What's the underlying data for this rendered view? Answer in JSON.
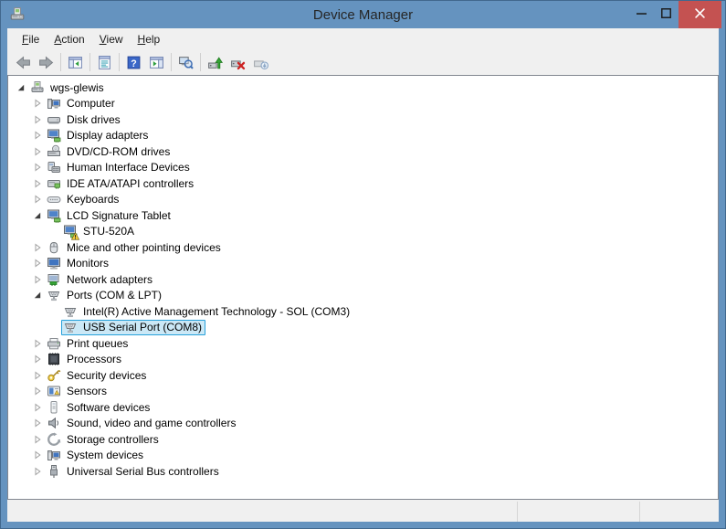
{
  "window": {
    "title": "Device Manager"
  },
  "menu": {
    "items": [
      {
        "label": "File"
      },
      {
        "label": "Action"
      },
      {
        "label": "View"
      },
      {
        "label": "Help"
      }
    ]
  },
  "toolbar": {
    "groups": [
      {
        "buttons": [
          {
            "name": "back",
            "enabled": false
          },
          {
            "name": "forward",
            "enabled": false
          }
        ]
      },
      {
        "buttons": [
          {
            "name": "show-hide-console-tree",
            "enabled": true
          }
        ]
      },
      {
        "buttons": [
          {
            "name": "properties",
            "enabled": true
          }
        ]
      },
      {
        "buttons": [
          {
            "name": "help",
            "enabled": true
          },
          {
            "name": "show-hide-action-pane",
            "enabled": true
          }
        ]
      },
      {
        "buttons": [
          {
            "name": "scan-for-hardware-changes",
            "enabled": true
          }
        ]
      },
      {
        "buttons": [
          {
            "name": "update-driver",
            "enabled": true
          },
          {
            "name": "uninstall",
            "enabled": true
          },
          {
            "name": "disable",
            "enabled": true
          }
        ]
      }
    ]
  },
  "tree": {
    "items": [
      {
        "label": "wgs-glewis",
        "depth": 0,
        "state": "expanded",
        "icon": "computer-station-icon"
      },
      {
        "label": "Computer",
        "depth": 1,
        "state": "collapsed",
        "icon": "computer-icon"
      },
      {
        "label": "Disk drives",
        "depth": 1,
        "state": "collapsed",
        "icon": "disk-drive-icon"
      },
      {
        "label": "Display adapters",
        "depth": 1,
        "state": "collapsed",
        "icon": "display-adapter-icon"
      },
      {
        "label": "DVD/CD-ROM drives",
        "depth": 1,
        "state": "collapsed",
        "icon": "dvd-drive-icon"
      },
      {
        "label": "Human Interface Devices",
        "depth": 1,
        "state": "collapsed",
        "icon": "hid-icon"
      },
      {
        "label": "IDE ATA/ATAPI controllers",
        "depth": 1,
        "state": "collapsed",
        "icon": "ide-controller-icon"
      },
      {
        "label": "Keyboards",
        "depth": 1,
        "state": "collapsed",
        "icon": "keyboard-icon"
      },
      {
        "label": "LCD Signature Tablet",
        "depth": 1,
        "state": "expanded",
        "icon": "display-adapter-icon"
      },
      {
        "label": "STU-520A",
        "depth": 2,
        "state": "none",
        "icon": "display-adapter-icon",
        "warning": true
      },
      {
        "label": "Mice and other pointing devices",
        "depth": 1,
        "state": "collapsed",
        "icon": "mouse-icon"
      },
      {
        "label": "Monitors",
        "depth": 1,
        "state": "collapsed",
        "icon": "monitor-icon"
      },
      {
        "label": "Network adapters",
        "depth": 1,
        "state": "collapsed",
        "icon": "network-adapter-icon"
      },
      {
        "label": "Ports (COM & LPT)",
        "depth": 1,
        "state": "expanded",
        "icon": "serial-port-icon"
      },
      {
        "label": "Intel(R) Active Management Technology - SOL (COM3)",
        "depth": 2,
        "state": "none",
        "icon": "serial-port-icon"
      },
      {
        "label": "USB Serial Port (COM8)",
        "depth": 2,
        "state": "none",
        "icon": "serial-port-icon",
        "selected": true
      },
      {
        "label": "Print queues",
        "depth": 1,
        "state": "collapsed",
        "icon": "printer-icon"
      },
      {
        "label": "Processors",
        "depth": 1,
        "state": "collapsed",
        "icon": "processor-icon"
      },
      {
        "label": "Security devices",
        "depth": 1,
        "state": "collapsed",
        "icon": "security-device-icon"
      },
      {
        "label": "Sensors",
        "depth": 1,
        "state": "collapsed",
        "icon": "sensor-icon"
      },
      {
        "label": "Software devices",
        "depth": 1,
        "state": "collapsed",
        "icon": "software-device-icon"
      },
      {
        "label": "Sound, video and game controllers",
        "depth": 1,
        "state": "collapsed",
        "icon": "sound-icon"
      },
      {
        "label": "Storage controllers",
        "depth": 1,
        "state": "collapsed",
        "icon": "storage-controller-icon"
      },
      {
        "label": "System devices",
        "depth": 1,
        "state": "collapsed",
        "icon": "computer-icon"
      },
      {
        "label": "Universal Serial Bus controllers",
        "depth": 1,
        "state": "collapsed",
        "icon": "usb-icon"
      }
    ]
  },
  "status_bar": {
    "sections": [
      "",
      "",
      ""
    ]
  },
  "colors": {
    "titlebar": "#6593bf",
    "close_button": "#c45251",
    "chrome_bg": "#f0f0f0",
    "tree_bg": "#ffffff",
    "tree_border": "#828790",
    "selection_bg": "#cbe8f6",
    "selection_border": "#26a0da",
    "warning": "#f7d13e"
  }
}
